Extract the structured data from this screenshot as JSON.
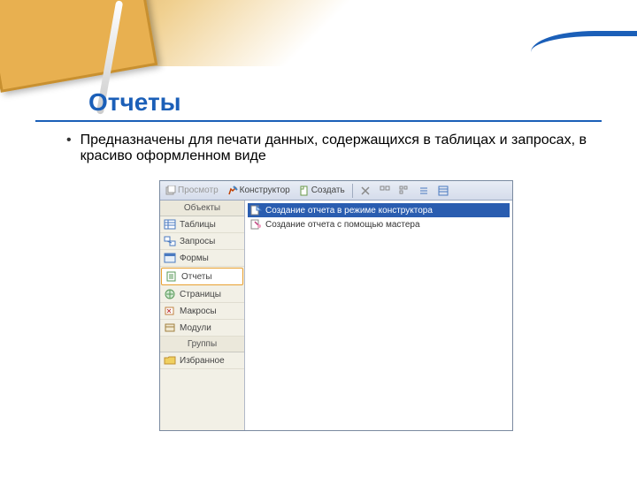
{
  "slide": {
    "title": "Отчеты",
    "bullet": "Предназначены для печати данных, содержащихся в таблицах и запросах, в красиво оформленном виде"
  },
  "toolbar": {
    "preview": "Просмотр",
    "designer": "Конструктор",
    "create": "Создать"
  },
  "sidebar": {
    "objects_header": "Объекты",
    "groups_header": "Группы",
    "items": [
      {
        "label": "Таблицы"
      },
      {
        "label": "Запросы"
      },
      {
        "label": "Формы"
      },
      {
        "label": "Отчеты"
      },
      {
        "label": "Страницы"
      },
      {
        "label": "Макросы"
      },
      {
        "label": "Модули"
      }
    ],
    "favorites": "Избранное"
  },
  "main": {
    "row1": "Создание отчета в режиме конструктора",
    "row2": "Создание отчета с помощью мастера"
  }
}
